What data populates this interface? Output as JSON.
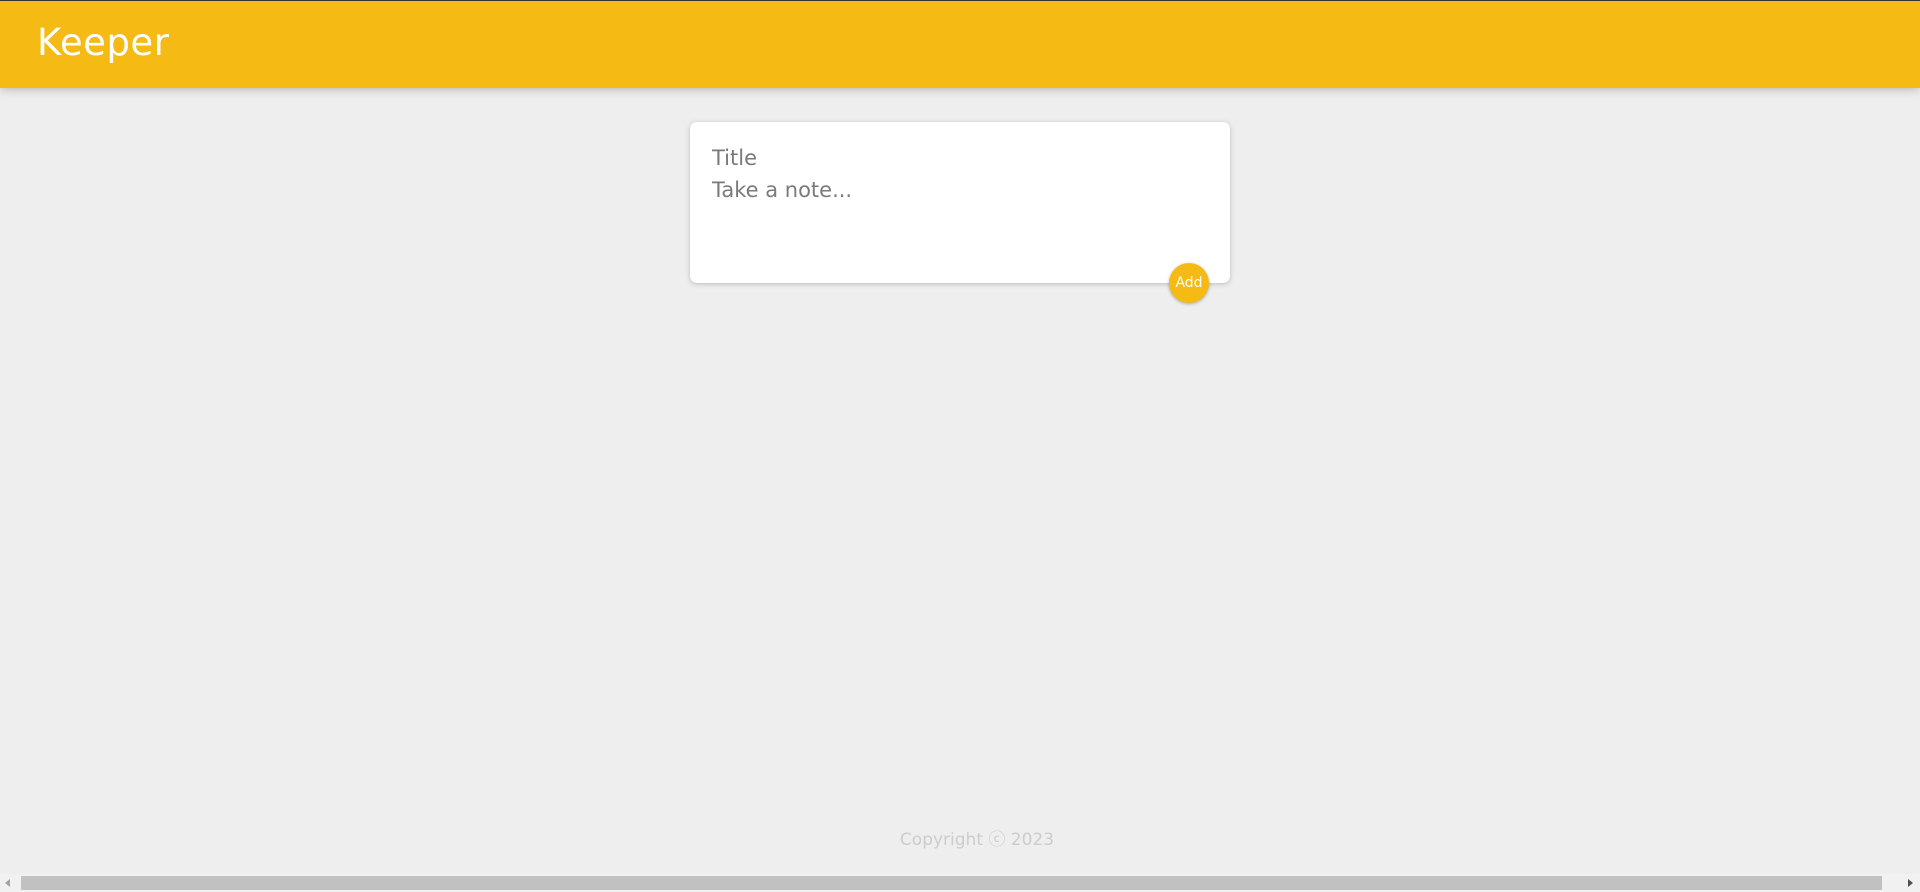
{
  "header": {
    "logo_text": "Keeper"
  },
  "note_form": {
    "title_placeholder": "Title",
    "content_placeholder": "Take a note...",
    "add_label": "Add"
  },
  "footer": {
    "copyright": "Copyright ⓒ 2023"
  },
  "colors": {
    "accent": "#f5ba13",
    "background": "#eeeeee",
    "footer_text": "#cccccc"
  }
}
